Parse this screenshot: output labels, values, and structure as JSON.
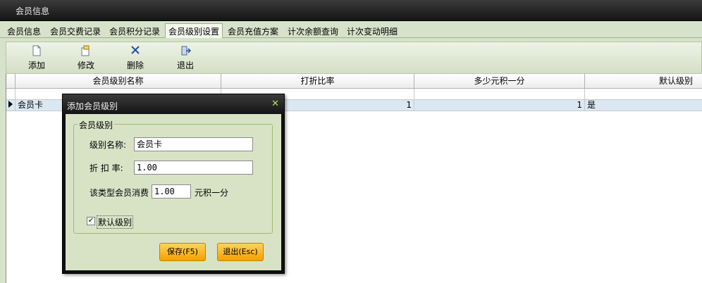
{
  "window": {
    "title": "会员信息"
  },
  "tabs": [
    {
      "label": "会员信息"
    },
    {
      "label": "会员交费记录"
    },
    {
      "label": "会员积分记录"
    },
    {
      "label": "会员级别设置",
      "active": true
    },
    {
      "label": "会员充值方案"
    },
    {
      "label": "计次余额查询"
    },
    {
      "label": "计次变动明细"
    }
  ],
  "toolbar": {
    "add": {
      "label": "添加",
      "icon": "document-icon"
    },
    "edit": {
      "label": "修改",
      "icon": "edit-icon"
    },
    "delete": {
      "label": "删除",
      "icon": "delete-x-icon"
    },
    "exit": {
      "label": "退出",
      "icon": "exit-door-icon"
    }
  },
  "grid": {
    "columns": [
      "会员级别名称",
      "打折比率",
      "多少元积一分",
      "默认级别"
    ],
    "rows": [
      {
        "name": "会员卡",
        "discount": "1",
        "points_per": "1",
        "default": "是",
        "selected": true
      }
    ]
  },
  "dialog": {
    "title": "添加会员级别",
    "group_label": "会员级别",
    "name_label": "级别名称:",
    "name_value": "会员卡",
    "discount_label": "折 扣 率:",
    "discount_value": "1.00",
    "consume_label": "该类型会员消费",
    "consume_value": "1.00",
    "consume_suffix": "元积一分",
    "default_checkbox_label": "默认级别",
    "default_checked": true,
    "save_button": "保存(F5)",
    "exit_button": "退出(Esc)"
  },
  "colors": {
    "panel_bg": "#d6e2c9",
    "button_orange": "#f5a100",
    "title_dark": "#141414"
  }
}
